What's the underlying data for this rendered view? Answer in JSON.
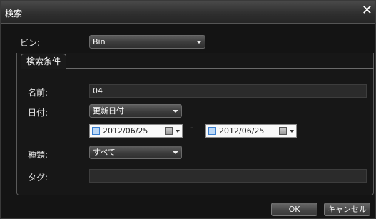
{
  "dialog": {
    "title": "検索",
    "close_symbol": "✕"
  },
  "bin": {
    "label": "ビン:",
    "value": "Bin"
  },
  "tabs": [
    {
      "label": "検索条件",
      "selected": true
    }
  ],
  "criteria": {
    "name": {
      "label": "名前:",
      "value": "04"
    },
    "date": {
      "label": "日付:",
      "mode": "更新日付",
      "separator": "-",
      "from": {
        "value": "2012/06/25",
        "checked": false
      },
      "to": {
        "value": "2012/06/25",
        "checked": false
      }
    },
    "kind": {
      "label": "種類:",
      "value": "すべて"
    },
    "tag": {
      "label": "タグ:",
      "value": ""
    }
  },
  "footer": {
    "ok_label": "OK",
    "cancel_label": "キャンセル"
  },
  "icons": {
    "combo_arrow": "chevron-down-icon",
    "calendar": "calendar-icon",
    "checkbox": "checkbox-icon"
  }
}
